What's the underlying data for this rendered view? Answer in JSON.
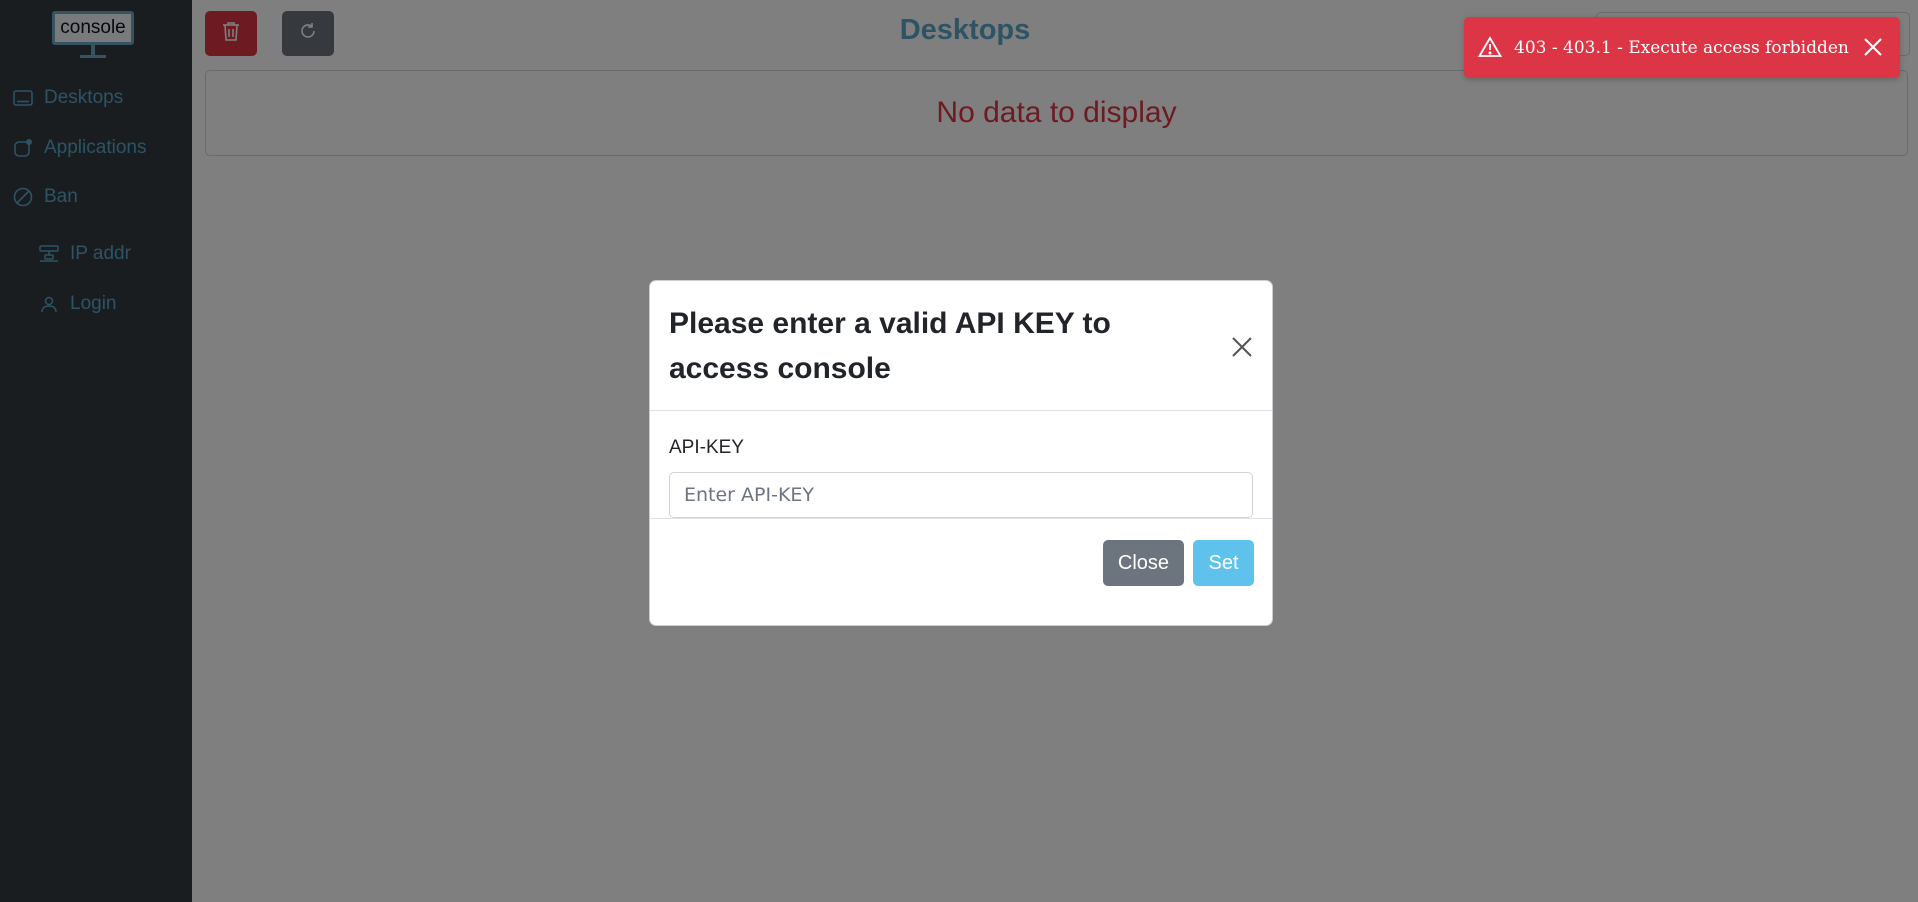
{
  "sidebar": {
    "logo_text": "console",
    "items": [
      {
        "label": "Desktops",
        "icon": "desktop-icon"
      },
      {
        "label": "Applications",
        "icon": "applications-icon"
      },
      {
        "label": "Ban",
        "icon": "ban-icon"
      },
      {
        "label": "IP addr",
        "icon": "network-icon"
      },
      {
        "label": "Login",
        "icon": "user-icon"
      }
    ]
  },
  "main": {
    "title": "Desktops",
    "empty_message": "No data to display",
    "delete_icon": "trash-icon",
    "refresh_icon": "refresh-icon"
  },
  "toast": {
    "message": "403 - 403.1 - Execute access forbidden",
    "icon": "warning-icon",
    "color": "#dc3545"
  },
  "modal": {
    "title": "Please enter a valid API KEY to access console",
    "field_label": "API-KEY",
    "input_value": "",
    "input_placeholder": "Enter API-KEY",
    "close_label": "Close",
    "set_label": "Set"
  },
  "colors": {
    "accent": "#5aa7c9",
    "danger": "#dc3545",
    "secondary": "#6c757d",
    "set_button": "#5ec2ec",
    "sidebar_bg": "#343a40"
  }
}
